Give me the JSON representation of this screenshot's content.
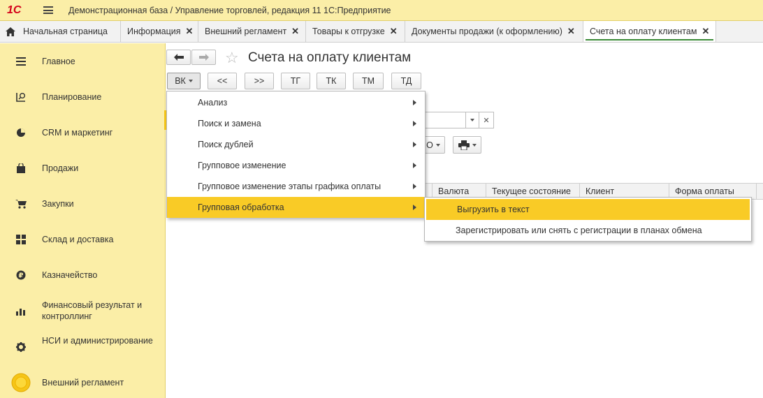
{
  "app": {
    "logo_text": "1С",
    "title": "Демонстрационная база / Управление торговлей, редакция 11 1С:Предприятие"
  },
  "tabs": [
    {
      "label": "Начальная страница",
      "closable": false,
      "active": false
    },
    {
      "label": "Информация",
      "closable": true,
      "active": false
    },
    {
      "label": "Внешний регламент",
      "closable": true,
      "active": false
    },
    {
      "label": "Товары к отгрузке",
      "closable": true,
      "active": false
    },
    {
      "label": "Документы продажи (к оформлению)",
      "closable": true,
      "active": false
    },
    {
      "label": "Счета на оплату клиентам",
      "closable": true,
      "active": true
    }
  ],
  "tab_close_glyph": "✕",
  "sidebar": {
    "items": [
      {
        "label": "Главное",
        "icon": "menu-lines-icon"
      },
      {
        "label": "Планирование",
        "icon": "planning-icon"
      },
      {
        "label": "CRM и маркетинг",
        "icon": "pie-chart-icon"
      },
      {
        "label": "Продажи",
        "icon": "shopping-bag-icon"
      },
      {
        "label": "Закупки",
        "icon": "shopping-cart-icon"
      },
      {
        "label": "Склад и доставка",
        "icon": "warehouse-grid-icon"
      },
      {
        "label": "Казначейство",
        "icon": "ruble-coin-icon"
      },
      {
        "label": "Финансовый результат и контроллинг",
        "icon": "bar-chart-icon"
      },
      {
        "label": "НСИ и администрирование",
        "icon": "gear-icon"
      },
      {
        "label": "Внешний регламент",
        "icon": "yellow-circle-icon"
      }
    ]
  },
  "form": {
    "title": "Счета на оплату клиентам",
    "back_glyph": "🡐",
    "forward_glyph": "🡒",
    "star_glyph": "☆"
  },
  "toolbar": {
    "buttons": [
      "ВК",
      "<<",
      ">>",
      "ТГ",
      "ТК",
      "ТМ",
      "ТД"
    ],
    "partial_button_text": "О"
  },
  "filter": {
    "clear_glyph": "✕"
  },
  "grid": {
    "columns": [
      "Валюта",
      "Текущее состояние",
      "Клиент",
      "Форма оплаты"
    ]
  },
  "menu": {
    "items": [
      {
        "label": "Анализ",
        "submenu": true
      },
      {
        "label": "Поиск и замена",
        "submenu": true
      },
      {
        "label": "Поиск дублей",
        "submenu": true
      },
      {
        "label": "Групповое изменение",
        "submenu": true
      },
      {
        "label": "Групповое изменение этапы графика оплаты",
        "submenu": true
      },
      {
        "label": "Групповая обработка",
        "submenu": true,
        "highlighted": true
      }
    ]
  },
  "submenu": {
    "items": [
      {
        "label": "Выгрузить в текст",
        "highlighted": true
      },
      {
        "label": "Зарегистрировать или снять с регистрации в планах обмена"
      }
    ]
  },
  "colors": {
    "sidebar_bg": "#fbeea7",
    "highlight": "#f9cb26",
    "logo_red": "#d4001a",
    "active_tab_underline": "#3a8a36"
  }
}
